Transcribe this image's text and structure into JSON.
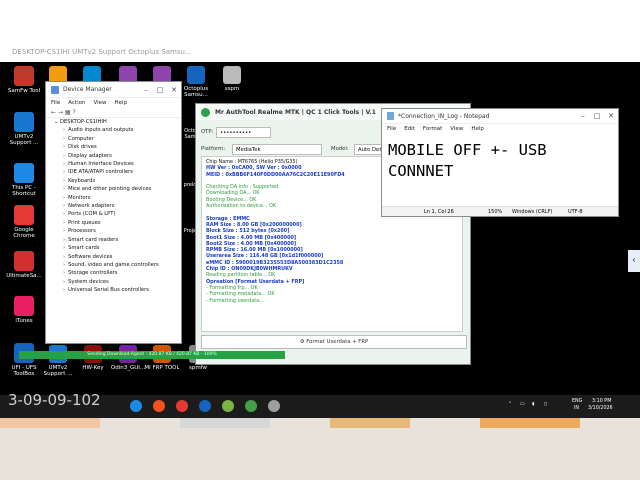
{
  "top_overlay_text": "DESKTOP-CS1IHI     UMTv2 Support      Octoplus Samsu...",
  "desktop_icons_left": [
    {
      "label": "SamFw Tool",
      "color": "#c0392b"
    },
    {
      "label": "UMTv2 Support ...",
      "color": "#1976d2"
    },
    {
      "label": "This PC - Shortcut",
      "color": "#1e88e5"
    },
    {
      "label": "Google Chrome",
      "color": "#e53935"
    },
    {
      "label": "UltimateSa...",
      "color": "#d32f2f"
    },
    {
      "label": "iTunes",
      "color": "#e91e63"
    },
    {
      "label": "UFI - UFS ToolBox",
      "color": "#1565c0"
    }
  ],
  "desktop_icons_bottom": [
    {
      "label": "UMTv2 Support ...",
      "color": "#1976d2"
    },
    {
      "label": "HW-Key",
      "color": "#8e0e0e"
    },
    {
      "label": "Odin3_GUI...",
      "color": "#7a1fa2"
    },
    {
      "label": "Mi FRP TOOL",
      "color": "#d35400"
    },
    {
      "label": "spmfw",
      "color": "#888888"
    }
  ],
  "desktop_icons_top": [
    {
      "label": "",
      "color": "#f39c12"
    },
    {
      "label": "",
      "color": "#0288d1"
    },
    {
      "label": "",
      "color": "#8e44ad"
    },
    {
      "label": "",
      "color": "#8e44ad"
    },
    {
      "label": "Octoplus Samsu...",
      "color": "#1565c0"
    },
    {
      "label": "sspm",
      "color": "#bbbbbb"
    }
  ],
  "desktop_partial_labels": [
    "Octo Sam",
    "prelo",
    "Proje"
  ],
  "device_manager": {
    "title": "Device Manager",
    "menu": [
      "File",
      "Action",
      "View",
      "Help"
    ],
    "root": "DESKTOP-CS1IHIH",
    "items": [
      "Audio inputs and outputs",
      "Computer",
      "Disk drives",
      "Display adapters",
      "Human Interface Devices",
      "IDE ATA/ATAPI controllers",
      "Keyboards",
      "Mice and other pointing devices",
      "Monitors",
      "Network adapters",
      "Ports (COM & LPT)",
      "Print queues",
      "Processors",
      "Smart card readers",
      "Smart cards",
      "Software devices",
      "Sound, video and game controllers",
      "Storage controllers",
      "System devices",
      "Universal Serial Bus controllers"
    ]
  },
  "mrt": {
    "title": "Mr AuthTool Realme MTK | QC 1 Click Tools | V.1",
    "otp_label": "OTP:",
    "otp_value": "••••••••••",
    "platform_label": "Platform:",
    "platform_value": "MediaTek",
    "model_label": "Model:",
    "model_value": "Auto Dete",
    "log_lines": [
      {
        "t": "Chip Name : MT6765 (Helio P35/G35)",
        "c": "k"
      },
      {
        "t": "HW Ver : 0xCA00, SW Ver : 0x0000",
        "c": "b"
      },
      {
        "t": "MEID : 0xBBB6F140F0DD00AA76C2C20E11E90FD4",
        "c": "b"
      },
      {
        "t": "",
        "c": "k"
      },
      {
        "t": "Checking DA info : Supported",
        "c": "g"
      },
      {
        "t": "Downloading DA... OK",
        "c": "g"
      },
      {
        "t": "Booting Device... OK",
        "c": "g"
      },
      {
        "t": "Authorization to device... OK",
        "c": "g"
      },
      {
        "t": "",
        "c": "k"
      },
      {
        "t": "Storage : EMMC",
        "c": "b"
      },
      {
        "t": "RAM Size : 8.00 GB [0x200000000]",
        "c": "b"
      },
      {
        "t": "Block Size : 512 bytes [0x200]",
        "c": "b"
      },
      {
        "t": "Boot1 Size : 4.00 MB [0x400000]",
        "c": "b"
      },
      {
        "t": "Boot2 Size : 4.00 MB [0x400000]",
        "c": "b"
      },
      {
        "t": "RPMB Size : 16.00 MB [0x1000000]",
        "c": "b"
      },
      {
        "t": "Userarea Size : 116.48 GB [0x1d1f000000]",
        "c": "b"
      },
      {
        "t": "eMMC ID : 5900019B3235553D8A500383D1C2358",
        "c": "b"
      },
      {
        "t": "Chip ID : ON09DKJB0WHMRUKV",
        "c": "b"
      },
      {
        "t": "Reading partition table... OK",
        "c": "g"
      },
      {
        "t": "Opreation [Format Userdata + FRP]",
        "c": "b"
      },
      {
        "t": " - Formatting frp... OK",
        "c": "g"
      },
      {
        "t": " - Formatting metadata... OK",
        "c": "g"
      },
      {
        "t": " - Formatting userdata...",
        "c": "g"
      }
    ],
    "format_button": "Format Userdata + FRP",
    "progress_text": "Sending Download-Agent : 420.87 KB / 420.87 KB - 100%",
    "progress_percent": 100
  },
  "notepad": {
    "title": "*Connection_IN_Log - Notepad",
    "menu": [
      "File",
      "Edit",
      "Format",
      "View",
      "Help"
    ],
    "text": "MOBILE OFF +- USB\nCONNNET",
    "status_pos": "Ln 1, Col 26",
    "status_zoom": "150%",
    "status_eol": "Windows (CRLF)",
    "status_enc": "UTF-8"
  },
  "taskbar": {
    "overlay_text": "3-09-09-102",
    "lang": "ENG",
    "lang2": "IN",
    "time": "3:10 PM",
    "date": "3/10/2026",
    "icon_colors": [
      "#1e88e5",
      "#f4511e",
      "#e53935",
      "#1565c0",
      "#7cb342",
      "#43a047",
      "#9e9e9e"
    ]
  }
}
